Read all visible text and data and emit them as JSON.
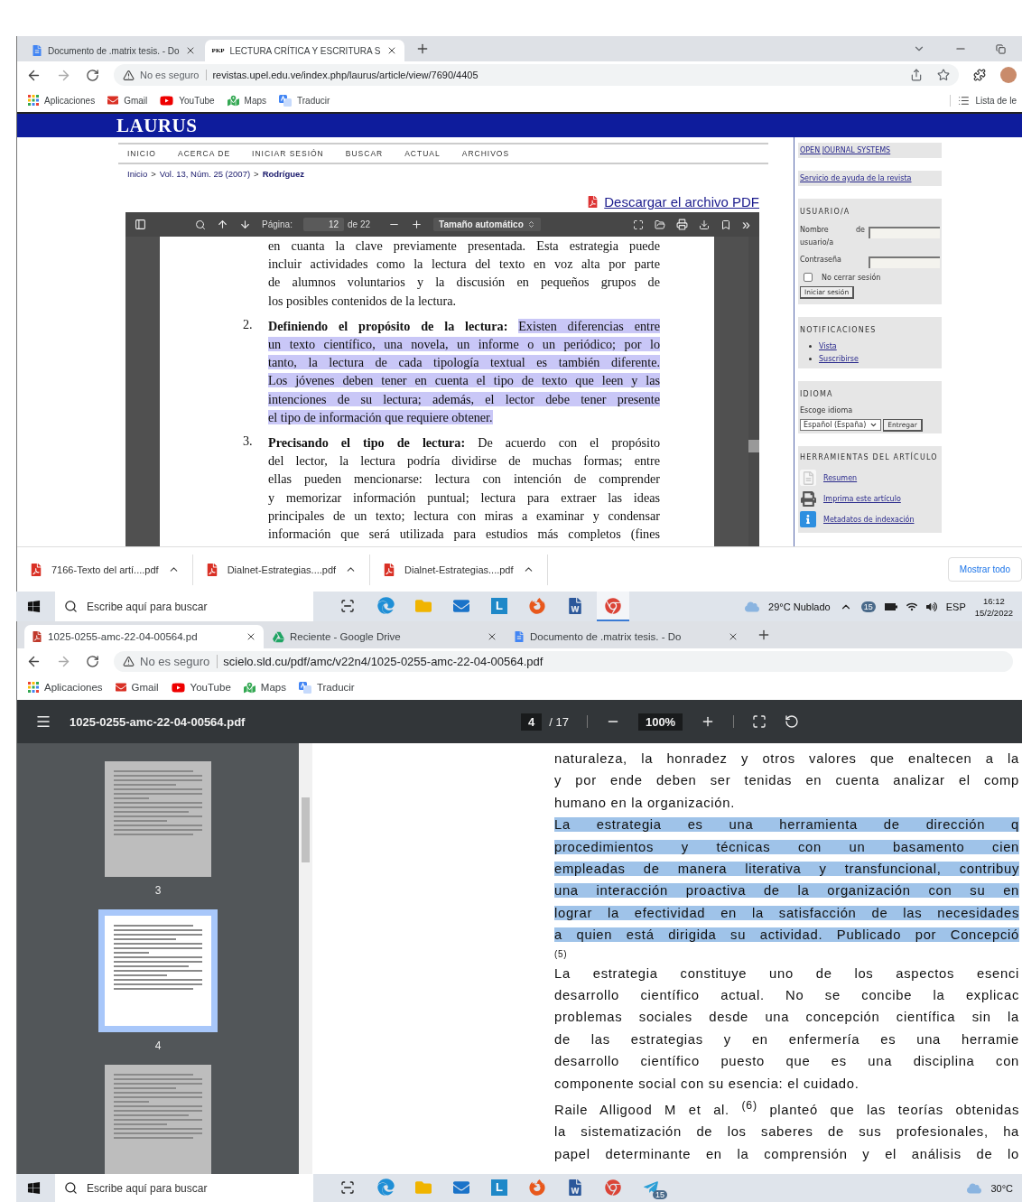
{
  "window1": {
    "window_controls": true,
    "toolbar_icons": true,
    "tabs": [
      {
        "kind": "docs",
        "title": "Documento de .matrix tesis. - Do",
        "selected": false
      },
      {
        "kind": "pkp",
        "favicon_text": "PKP",
        "title": "LECTURA CRÍTICA Y ESCRITURA S",
        "selected": true
      }
    ],
    "address": {
      "security": "No es seguro",
      "url": "revistas.upel.edu.ve/index.php/laurus/article/view/7690/4405"
    },
    "bookmarks": [
      {
        "kind": "apps",
        "label": "Aplicaciones"
      },
      {
        "kind": "gmail",
        "label": "Gmail"
      },
      {
        "kind": "youtube",
        "label": "YouTube"
      },
      {
        "kind": "maps",
        "label": "Maps"
      },
      {
        "kind": "translate",
        "label": "Traducir"
      }
    ],
    "reading_list": "Lista de le",
    "site": {
      "logo": "LAURUS",
      "nav": [
        "INICIO",
        "ACERCA DE",
        "INICIAR SESIÓN",
        "BUSCAR",
        "ACTUAL",
        "ARCHIVOS"
      ],
      "breadcrumb": [
        {
          "label": "Inicio",
          "current": false
        },
        {
          "label": "Vol. 13, Núm. 25 (2007)",
          "current": false
        },
        {
          "label": "Rodríguez",
          "current": true
        }
      ],
      "breadcrumb_separator": ">",
      "download_link": "Descargar el archivo PDF",
      "viewer": {
        "page_label": "Página:",
        "page": "12",
        "page_count": "de 22",
        "zoom": "Tamaño automático",
        "more": "»",
        "blocks": [
          {
            "continues": false,
            "lines": [
              {
                "text": "en cuanta la clave previamente presentada. Esta estrategia puede",
                "highlighted": false
              },
              {
                "text": "incluir actividades como la lectura del texto en voz alta por parte",
                "highlighted": false
              },
              {
                "text": "de alumnos voluntarios y la discusión en pequeños grupos de",
                "highlighted": false
              },
              {
                "text": "los posibles contenidos de la lectura.",
                "highlighted": false
              }
            ]
          },
          {
            "number": "2.",
            "continues": false,
            "lines": [
              {
                "lead": "Definiendo el propósito de la lectura:",
                "text": "Existen diferencias entre",
                "highlighted": true
              },
              {
                "text": "un texto científico, una novela, un informe o un periódico; por lo",
                "highlighted": true
              },
              {
                "text": "tanto, la lectura de cada tipología textual es también diferente.",
                "highlighted": true
              },
              {
                "text": "Los jóvenes deben tener en cuenta el tipo de texto que leen y las",
                "highlighted": true
              },
              {
                "text": "intenciones de su lectura; además, el lector debe tener presente",
                "highlighted": true
              },
              {
                "text": "el tipo de información que requiere obtener.",
                "highlighted": true
              }
            ]
          },
          {
            "number": "3.",
            "continues": true,
            "lines": [
              {
                "lead": "Precisando el tipo de lectura:",
                "text": "De acuerdo con el propósito",
                "highlighted": false
              },
              {
                "text": "del lector, la lectura podría dividirse de muchas formas; entre",
                "highlighted": false
              },
              {
                "text": "ellas pueden mencionarse: lectura con intención de comprender",
                "highlighted": false
              },
              {
                "text": "y memorizar información puntual; lectura para extraer las ideas",
                "highlighted": false
              },
              {
                "text": "principales de un texto; lectura con miras a examinar y condensar",
                "highlighted": false
              },
              {
                "text": "información que será utilizada para estudios más completos (fines",
                "highlighted": false
              }
            ]
          }
        ]
      }
    },
    "sidebar": [
      {
        "kind": "link",
        "label": "OPEN JOURNAL SYSTEMS"
      },
      {
        "kind": "link",
        "label": "Servicio de ayuda de la revista"
      },
      {
        "kind": "login",
        "title": "USUARIO/A",
        "username_label": "Nombre de usuario/a",
        "password_label": "Contraseña",
        "remember": {
          "label": "No cerrar sesión",
          "checked": false
        },
        "submit": "Iniciar sesión"
      },
      {
        "kind": "list",
        "title": "NOTIFICACIONES",
        "links": [
          "Vista",
          "Suscribirse"
        ]
      },
      {
        "kind": "language",
        "title": "IDIOMA",
        "label": "Escoge idioma",
        "value": "Español (España)",
        "submit": "Entregar"
      },
      {
        "kind": "tools",
        "title": "HERRAMIENTAS DEL ARTÍCULO",
        "tools": [
          {
            "kind": "page",
            "label": "Resumen"
          },
          {
            "kind": "printer",
            "label": "Imprima este artículo"
          },
          {
            "kind": "info",
            "label": "Metadatos de indexación"
          }
        ]
      }
    ],
    "downloads": {
      "items": [
        "7166-Texto del artí....pdf",
        "Dialnet-Estrategias....pdf",
        "Dialnet-Estrategias....pdf"
      ],
      "show_all": "Mostrar todo"
    }
  },
  "taskbar1": {
    "search": "Escribe aquí para buscar",
    "apps": [
      {
        "kind": "taskview",
        "active": false
      },
      {
        "kind": "edge",
        "active": false
      },
      {
        "kind": "explorer",
        "active": false
      },
      {
        "kind": "mail",
        "active": false
      },
      {
        "kind": "tile",
        "glyph": "L",
        "active": false
      },
      {
        "kind": "firefox",
        "active": false
      },
      {
        "kind": "word",
        "active": false
      },
      {
        "kind": "chrome",
        "active": true
      }
    ],
    "weather": "29°C  Nublado",
    "tray_badge": "15",
    "language": "ESP",
    "time": "16:12",
    "date": "15/2/2022"
  },
  "window2": {
    "window_controls": false,
    "toolbar_icons": false,
    "tabs": [
      {
        "kind": "pdf",
        "title": "1025-0255-amc-22-04-00564.pd",
        "selected": true
      },
      {
        "kind": "drive",
        "title": "Reciente - Google Drive",
        "selected": false
      },
      {
        "kind": "docs",
        "title": "Documento de .matrix tesis. - Do",
        "selected": false
      }
    ],
    "address": {
      "security": "No es seguro",
      "url": "scielo.sld.cu/pdf/amc/v22n4/1025-0255-amc-22-04-00564.pdf"
    },
    "bookmarks": [
      {
        "kind": "apps",
        "label": "Aplicaciones"
      },
      {
        "kind": "gmail",
        "label": "Gmail"
      },
      {
        "kind": "youtube",
        "label": "YouTube"
      },
      {
        "kind": "maps",
        "label": "Maps"
      },
      {
        "kind": "translate",
        "label": "Traducir"
      }
    ],
    "pdf": {
      "file": "1025-0255-amc-22-04-00564.pdf",
      "page": "4",
      "page_count": "/ 17",
      "zoom": "100%",
      "thumbnails": [
        {
          "label": "3",
          "selected": false
        },
        {
          "label": "4",
          "selected": true
        },
        {
          "selected": false
        }
      ],
      "paragraphs": [
        {
          "continues": false,
          "lines": [
            "naturaleza, la honradez y otros valores que enaltecen a la",
            "y por ende deben ser tenidas en cuenta analizar el comp",
            "humano en la organización."
          ],
          "highlighted": false
        },
        {
          "continues": true,
          "lines": [
            "La estrategia es una herramienta de dirección q",
            "procedimientos y técnicas con un basamento cien",
            "empleadas de manera literativa y transfuncional, contribuy",
            "una interacción proactiva de la organización con su en",
            "lograr la efectividad en la satisfacción de las necesidades",
            "a quien está dirigida su actividad. Publicado por Concepció"
          ],
          "highlighted": true,
          "reference": "(5)"
        },
        {
          "continues": false,
          "lines": [
            "La estrategia constituye uno de los aspectos esenci",
            "desarrollo científico actual. No se concibe la explicac",
            "problemas sociales desde una concepción científica sin la",
            "de las estrategias y en enfermería es una herramie",
            "desarrollo científico puesto que es una disciplina con",
            "componente social con su esencia: el cuidado."
          ],
          "highlighted": false
        },
        {
          "continues": true,
          "lines": [
            "Raile Alligood M et al. $^{(6)}$ planteó que las teorías obtenidas",
            "la sistematización de los saberes de sus profesionales, ha",
            "papel determinante en la comprensión y el análisis de lo"
          ],
          "highlighted": false
        }
      ]
    }
  },
  "taskbar2": {
    "search": "Escribe aquí para buscar",
    "apps": [
      {
        "kind": "taskview",
        "active": false
      },
      {
        "kind": "edge",
        "active": false
      },
      {
        "kind": "explorer",
        "active": false
      },
      {
        "kind": "mail",
        "active": false
      },
      {
        "kind": "tile",
        "glyph": "L",
        "active": false
      },
      {
        "kind": "firefox",
        "active": false
      },
      {
        "kind": "word",
        "active": false
      },
      {
        "kind": "chrome",
        "active": false
      },
      {
        "kind": "telegram",
        "badge": "15",
        "active": false
      }
    ],
    "weather": "30°C"
  }
}
